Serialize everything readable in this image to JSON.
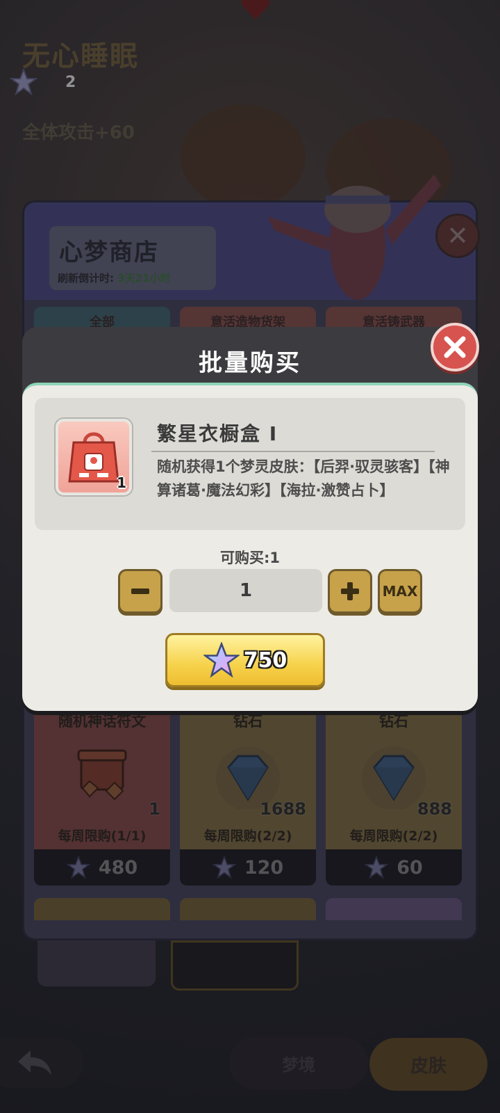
{
  "background": {
    "event_title": "无心睡眠",
    "star_count": "2",
    "bonus_text": "全体攻击+60"
  },
  "shop": {
    "title": "心梦商店",
    "refresh_label": "刷新倒计时:",
    "refresh_value": "3天21小时",
    "tabs": [
      "全部",
      "意活造物货架",
      "意活铸武器"
    ],
    "items": [
      {
        "name": "随机神话符文",
        "qty": "1",
        "limit": "每周限购(1/1)",
        "price": "480",
        "icon": "rune-chest-icon",
        "theme": "red"
      },
      {
        "name": "钻石",
        "qty": "1688",
        "limit": "每周限购(2/2)",
        "price": "120",
        "icon": "diamond-icon",
        "theme": "gold"
      },
      {
        "name": "钻石",
        "qty": "888",
        "limit": "每周限购(2/2)",
        "price": "60",
        "icon": "diamond-icon",
        "theme": "gold"
      }
    ]
  },
  "nav": {
    "center_label": "梦境",
    "skin_label": "皮肤"
  },
  "modal": {
    "title": "批量购买",
    "item": {
      "name": "繁星衣橱盒 I",
      "icon_qty": "1",
      "description": "随机获得1个梦灵皮肤：【后羿·驭灵骇客】【神算诸葛·魔法幻彩】【海拉·激赞占卜】"
    },
    "can_buy_label": "可购买:1",
    "quantity": "1",
    "max_label": "MAX",
    "price": "750"
  },
  "colors": {
    "accent_gold": "#f6d24b",
    "close_red": "#d6534f",
    "modal_frame": "#3c3b3f",
    "modal_body": "#ecebe6"
  }
}
